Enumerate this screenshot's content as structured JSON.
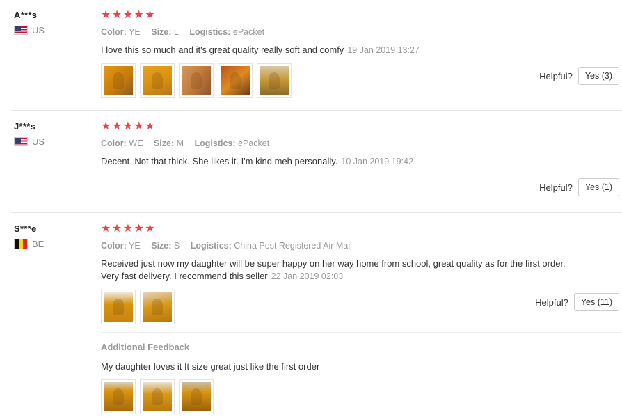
{
  "reviews": [
    {
      "user": "A***s",
      "country": "US",
      "stars": "★★★★★",
      "meta": {
        "color_label": "Color:",
        "color": "YE",
        "size_label": "Size:",
        "size": "L",
        "logistics_label": "Logistics:",
        "logistics": "ePacket"
      },
      "text": "I love this so much and it's great quality really soft and comfy",
      "date": "19 Jan 2019 13:27",
      "helpful_label": "Helpful?",
      "helpful_button": "Yes (3)",
      "photo_count": 5
    },
    {
      "user": "J***s",
      "country": "US",
      "stars": "★★★★★",
      "meta": {
        "color_label": "Color:",
        "color": "WE",
        "size_label": "Size:",
        "size": "M",
        "logistics_label": "Logistics:",
        "logistics": "ePacket"
      },
      "text": "Decent. Not that thick. She likes it. I'm kind meh personally.",
      "date": "10 Jan 2019 19:42",
      "helpful_label": "Helpful?",
      "helpful_button": "Yes (1)",
      "photo_count": 0
    },
    {
      "user": "S***e",
      "country": "BE",
      "stars": "★★★★★",
      "meta": {
        "color_label": "Color:",
        "color": "YE",
        "size_label": "Size:",
        "size": "S",
        "logistics_label": "Logistics:",
        "logistics": "China Post Registered Air Mail"
      },
      "text_line1": "Received just now my daughter will be super happy on her way home from school, great quality as for the first order.",
      "text_line2": "Very fast delivery. I recommend this seller",
      "date": "22 Jan 2019 02:03",
      "helpful_label": "Helpful?",
      "helpful_button": "Yes (11)",
      "photo_count": 2,
      "additional": {
        "title": "Additional Feedback",
        "text": "My daughter loves it It size great just like the first order",
        "photo_count": 3
      }
    }
  ],
  "colors": {
    "star": "#e6454d",
    "meta": "#999999",
    "flag_be_black": "#111111",
    "flag_be_yellow": "#f9d616",
    "flag_be_red": "#e2232b",
    "photo_mustard": "#d8940f"
  },
  "icons": {
    "rating": "star-icon",
    "us_flag": "us-flag-icon",
    "be_flag": "be-flag-icon"
  }
}
